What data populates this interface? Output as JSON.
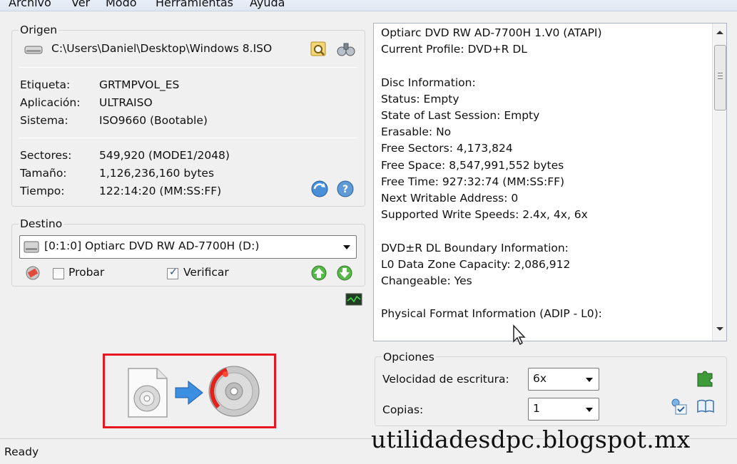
{
  "menu": [
    "Archivo",
    "Ver",
    "Modo",
    "Herramientas",
    "Ayuda"
  ],
  "origen": {
    "title": "Origen",
    "path": "C:\\Users\\Daniel\\Desktop\\Windows 8.ISO",
    "fields": [
      {
        "label": "Etiqueta:",
        "value": "GRTMPVOL_ES"
      },
      {
        "label": "Aplicación:",
        "value": "ULTRAISO"
      },
      {
        "label": "Sistema:",
        "value": "ISO9660 (Bootable)"
      },
      {
        "label": "Sectores:",
        "value": "549,920 (MODE1/2048)"
      },
      {
        "label": "Tamaño:",
        "value": "1,126,236,160 bytes"
      },
      {
        "label": "Tiempo:",
        "value": "122:14:20 (MM:SS:FF)"
      }
    ]
  },
  "destino": {
    "title": "Destino",
    "drive": "[0:1:0] Optiarc DVD RW AD-7700H (D:)",
    "probar_label": "Probar",
    "probar_checked": false,
    "verificar_label": "Verificar",
    "verificar_checked": true
  },
  "info_panel": {
    "lines": [
      "Optiarc DVD RW AD-7700H 1.V0 (ATAPI)",
      "Current Profile: DVD+R DL",
      "",
      "Disc Information:",
      "Status: Empty",
      "State of Last Session: Empty",
      "Erasable: No",
      "Free Sectors: 4,173,824",
      "Free Space: 8,547,991,552 bytes",
      "Free Time: 927:32:74 (MM:SS:FF)",
      "Next Writable Address: 0",
      "Supported Write Speeds: 2.4x, 4x, 6x",
      "",
      "DVD±R DL Boundary Information:",
      "L0 Data Zone Capacity: 2,086,912",
      "Changeable: Yes",
      "",
      "Physical Format Information (ADIP - L0):"
    ]
  },
  "opciones": {
    "title": "Opciones",
    "speed_label": "Velocidad de escritura:",
    "speed_value": "6x",
    "copies_label": "Copias:",
    "copies_value": "1"
  },
  "status_text": "Ready",
  "watermark": "utilidadesdpc.blogspot.mx",
  "icons": {
    "drive": "hard-drive-icon",
    "browse": "folder-search-icon",
    "mount": "binoculars-icon",
    "refresh": "refresh-globe-icon",
    "help": "help-globe-icon",
    "erase": "eraser-icon",
    "move_up": "green-up-arrow-icon",
    "move_down": "green-down-arrow-icon",
    "monitor": "monitor-icon",
    "burn_source": "iso-disc-icon",
    "burn_arrow": "blue-arrow-icon",
    "burn_target": "burning-disc-icon",
    "tools": "green-puzzle-icon",
    "checklist": "checklist-icon",
    "book": "book-icon"
  },
  "colors": {
    "highlight_box": "#e81522",
    "window_bg": "#f0f0f0",
    "check_mark": "#1d4e8a"
  }
}
